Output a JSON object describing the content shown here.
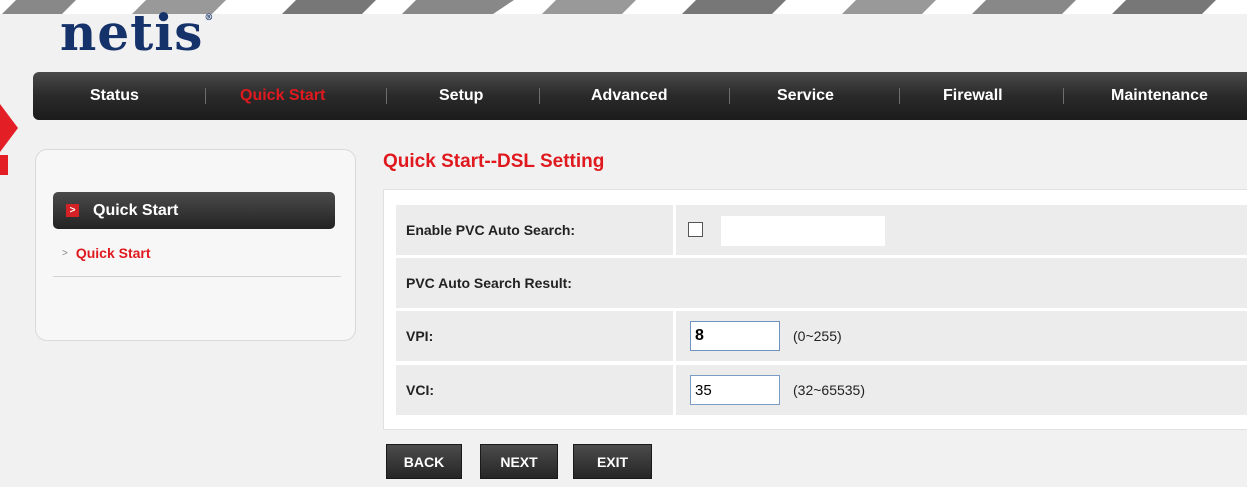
{
  "brand": {
    "logo_text": "netis",
    "logo_mark": "®"
  },
  "nav": {
    "items": [
      {
        "label": "Status"
      },
      {
        "label": "Quick Start"
      },
      {
        "label": "Setup"
      },
      {
        "label": "Advanced"
      },
      {
        "label": "Service"
      },
      {
        "label": "Firewall"
      },
      {
        "label": "Maintenance"
      }
    ],
    "active": "Quick Start"
  },
  "sidebar": {
    "section_label": "Quick Start",
    "items": [
      {
        "label": "Quick Start"
      }
    ]
  },
  "main": {
    "title": "Quick Start--DSL Setting",
    "form": {
      "pvc_auto_search_label": "Enable PVC Auto Search:",
      "pvc_auto_search_checked": false,
      "pvc_auto_search_result_label": "PVC Auto Search Result:",
      "vpi_label": "VPI:",
      "vpi_value": "8",
      "vpi_range": "(0~255)",
      "vci_label": "VCI:",
      "vci_value": "35",
      "vci_range": "(32~65535)"
    },
    "buttons": {
      "back": "BACK",
      "next": "NEXT",
      "exit": "EXIT"
    }
  },
  "colors": {
    "accent": "#e0191f",
    "nav_bg": "#2a2a2a",
    "logo": "#16326b"
  }
}
